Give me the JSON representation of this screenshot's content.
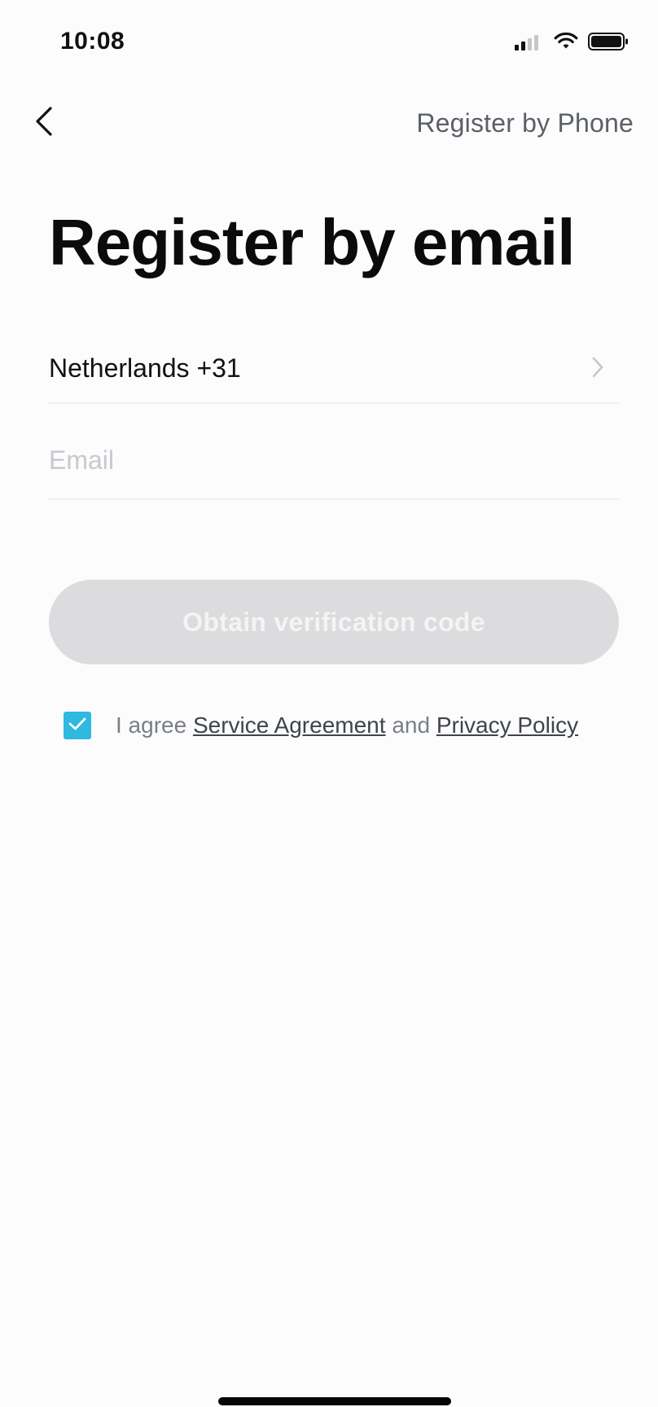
{
  "status_bar": {
    "time": "10:08",
    "signal_icon": "signal-icon",
    "wifi_icon": "wifi-icon",
    "battery_icon": "battery-icon"
  },
  "nav": {
    "back_icon": "chevron-left-icon",
    "secondary_action": "Register by Phone"
  },
  "page": {
    "title": "Register by email"
  },
  "form": {
    "country": {
      "label": "Netherlands +31",
      "icon": "chevron-right-icon"
    },
    "email": {
      "value": "",
      "placeholder": "Email"
    }
  },
  "actions": {
    "obtain_code_label": "Obtain verification code"
  },
  "agreement": {
    "checked": true,
    "prefix": "I agree",
    "service_agreement": "Service Agreement",
    "conjunction": "and",
    "privacy_policy": "Privacy Policy"
  },
  "colors": {
    "accent": "#2fb8e0",
    "button_disabled_bg": "#dcdcde",
    "button_disabled_text": "#f4f4f5",
    "background": "#fcfcfd"
  }
}
